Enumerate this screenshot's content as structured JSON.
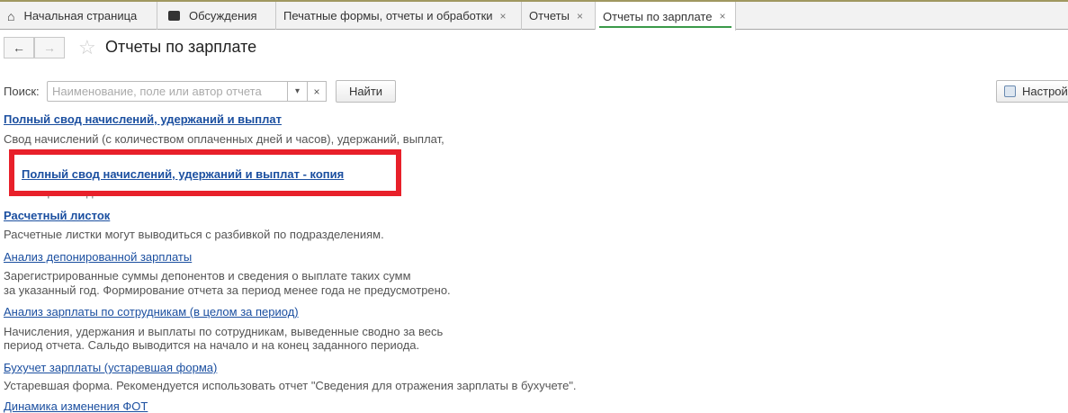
{
  "tabs": [
    {
      "label": "Начальная страница",
      "icon": "home-icon"
    },
    {
      "label": "Обсуждения",
      "icon": "chat-icon"
    },
    {
      "label": "Печатные формы, отчеты и обработки",
      "close": "×"
    },
    {
      "label": "Отчеты",
      "close": "×"
    },
    {
      "label": "Отчеты по зарплате",
      "close": "×",
      "active": true
    }
  ],
  "nav": {
    "back": "←",
    "forward": "→",
    "star": "☆"
  },
  "page_title": "Отчеты по зарплате",
  "search": {
    "label": "Поиск:",
    "placeholder": "Наименование, поле или автор отчета",
    "dropdown": "▾",
    "clear": "×",
    "find_label": "Найти"
  },
  "settings_label": "Настрой",
  "reports": [
    {
      "title": "Полный свод начислений, удержаний и выплат",
      "desc": [
        "Свод начислений (с количеством оплаченных дней и часов), удержаний, выплат,"
      ]
    },
    {
      "title": "Полный свод начислений, удержаний и выплат - копия",
      "desc": [
        "Автор: Кильдеева Алина Ринатовна"
      ]
    },
    {
      "title": "Расчетный листок",
      "desc": [
        "Расчетные листки могут выводиться с разбивкой по подразделениям."
      ]
    },
    {
      "title": "Анализ депонированной зарплаты",
      "desc": [
        "Зарегистрированные суммы депонентов и сведения о выплате таких сумм",
        "за указанный год. Формирование отчета за период менее года не предусмотрено."
      ]
    },
    {
      "title": "Анализ зарплаты по сотрудникам (в целом за период)",
      "desc": [
        "Начисления, удержания и выплаты по сотрудникам, выведенные сводно за весь",
        "период отчета. Сальдо выводится на начало и на конец заданного периода."
      ]
    },
    {
      "title": "Бухучет зарплаты (устаревшая форма)",
      "desc": [
        "Устаревшая форма. Рекомендуется использовать отчет \"Сведения для отражения зарплаты в бухучете\"."
      ]
    },
    {
      "title": "Динамика изменения ФОТ",
      "desc": []
    }
  ],
  "colors": {
    "link": "#1b4fa0",
    "highlight": "#e8202a",
    "active_tab": "#3a9a4a"
  }
}
